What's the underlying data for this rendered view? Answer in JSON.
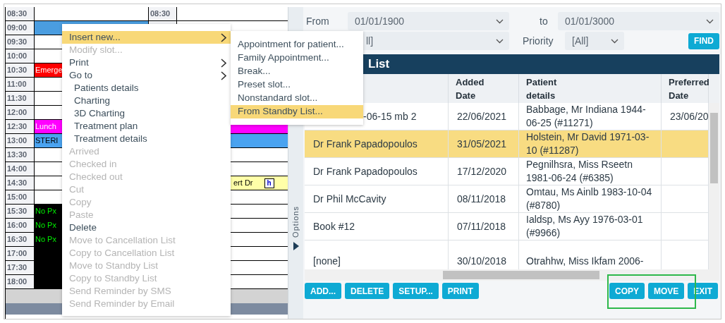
{
  "calendar": {
    "rows": [
      {
        "time": "08:30",
        "time_right": "08:30",
        "left": null,
        "right": null
      },
      {
        "time": "09:00",
        "left": {
          "kind": "appointment",
          "color": "#4a9de0"
        },
        "right": null
      },
      {
        "time": "09:30",
        "left": null,
        "right": null
      },
      {
        "time": "10:00",
        "left": null,
        "right": null
      },
      {
        "time": "10:30",
        "left": {
          "kind": "appointment",
          "color": "#ff0000",
          "text": "Emerge"
        },
        "right": null
      },
      {
        "time": "11:00",
        "left": null,
        "right": null
      },
      {
        "time": "11:30",
        "left": null,
        "right": null
      },
      {
        "time": "12:00",
        "left": null,
        "right": null
      },
      {
        "time": "12:30",
        "left": {
          "kind": "appointment",
          "color": "#ff00ff",
          "text": "Lunch"
        },
        "right": {
          "kind": "appointment",
          "color": "#ff00ff"
        }
      },
      {
        "time": "13:00",
        "left": {
          "kind": "appointment",
          "color": "#4aa3f0",
          "text": "STERI"
        },
        "right": {
          "kind": "appointment",
          "color": "#4aa3f0"
        }
      },
      {
        "time": "13:30",
        "left": null,
        "right": null
      },
      {
        "time": "14:00",
        "left": null,
        "right": null
      },
      {
        "time": "14:30",
        "left": null,
        "right": {
          "kind": "appointment",
          "color": "#ffffa8",
          "text": "ert Dr",
          "badge": "h"
        }
      },
      {
        "time": "15:00",
        "left": null,
        "right": null
      },
      {
        "time": "15:30",
        "left": {
          "kind": "blocked",
          "text": "No Px"
        },
        "right": null
      },
      {
        "time": "16:00",
        "left": {
          "kind": "blocked",
          "text": "No Px"
        },
        "right": null
      },
      {
        "time": "16:30",
        "left": {
          "kind": "blocked",
          "text": "No Px"
        },
        "right": null
      },
      {
        "time": "17:00",
        "left": {
          "kind": "blocked"
        },
        "right": null
      },
      {
        "time": "17:30",
        "left": {
          "kind": "blocked"
        },
        "right": null
      },
      {
        "time": "18:00",
        "left": {
          "kind": "blocked"
        },
        "right": null
      }
    ]
  },
  "context_menu": {
    "items": [
      {
        "label": "Insert new...",
        "disabled": false,
        "selected": true,
        "submenu": true
      },
      {
        "label": "Modify slot...",
        "disabled": true,
        "selected": false,
        "submenu": false
      },
      {
        "label": "Print",
        "disabled": false,
        "selected": false,
        "submenu": true
      },
      {
        "label": "Go to",
        "disabled": false,
        "selected": false,
        "submenu": true,
        "children": [
          {
            "label": "Patients details",
            "disabled": false,
            "selected": false,
            "submenu": false
          },
          {
            "label": "Charting",
            "disabled": false,
            "selected": false,
            "submenu": false
          },
          {
            "label": "3D Charting",
            "disabled": false,
            "selected": false,
            "submenu": false
          },
          {
            "label": "Treatment plan",
            "disabled": false,
            "selected": false,
            "submenu": false
          },
          {
            "label": "Treatment details",
            "disabled": false,
            "selected": false,
            "submenu": false
          }
        ]
      },
      {
        "label": "Arrived",
        "disabled": true,
        "selected": false,
        "submenu": false
      },
      {
        "label": "Checked in",
        "disabled": true,
        "selected": false,
        "submenu": false
      },
      {
        "label": "Checked out",
        "disabled": true,
        "selected": false,
        "submenu": false
      },
      {
        "label": "Cut",
        "disabled": true,
        "selected": false,
        "submenu": false
      },
      {
        "label": "Copy",
        "disabled": true,
        "selected": false,
        "submenu": false
      },
      {
        "label": "Paste",
        "disabled": true,
        "selected": false,
        "submenu": false
      },
      {
        "label": "Delete",
        "disabled": false,
        "selected": false,
        "submenu": false
      },
      {
        "label": "Move to Cancellation List",
        "disabled": true,
        "selected": false,
        "submenu": false
      },
      {
        "label": "Copy to Cancellation List",
        "disabled": true,
        "selected": false,
        "submenu": false
      },
      {
        "label": "Move to Standby List",
        "disabled": true,
        "selected": false,
        "submenu": false
      },
      {
        "label": "Copy to Standby List",
        "disabled": true,
        "selected": false,
        "submenu": false
      },
      {
        "label": "Send Reminder by SMS",
        "disabled": true,
        "selected": false,
        "submenu": false
      },
      {
        "label": "Send Reminder by Email",
        "disabled": true,
        "selected": false,
        "submenu": false
      }
    ]
  },
  "submenu": {
    "items": [
      {
        "label": "Appointment for patient...",
        "selected": false
      },
      {
        "label": "Family Appointment...",
        "selected": false
      },
      {
        "label": "Break...",
        "selected": false
      },
      {
        "label": "Preset slot...",
        "selected": false
      },
      {
        "label": "Nonstandard slot...",
        "selected": false
      },
      {
        "label": "From Standby List...",
        "selected": true
      }
    ]
  },
  "options_tab": {
    "label": "Options"
  },
  "filters": {
    "from": {
      "label": "From",
      "value": "01/01/1900"
    },
    "to": {
      "label": "to",
      "value": "01/01/3000"
    },
    "filter_2": {
      "value": "ll]"
    },
    "priority": {
      "label": "Priority",
      "value": "[All]"
    },
    "find_button": "FIND"
  },
  "list": {
    "title": "List",
    "columns": [
      "",
      "Added Date",
      "Patient details",
      "Preferred Date"
    ],
    "rows": [
      {
        "selected": false,
        "cells": [
          "-06-15 mb 2",
          "22/06/2021",
          "Babbage, Mr Indiana 1944-06-25 (#11271)",
          "23/06/20"
        ]
      },
      {
        "selected": true,
        "cells": [
          "Dr Frank Papadopoulos",
          "31/05/2021",
          "Holstein, Mr David 1971-03-10 (#11287)",
          ""
        ]
      },
      {
        "selected": false,
        "cells": [
          "Dr Frank Papadopoulos",
          "17/12/2020",
          "Pegnilhsra, Miss Rseetn 1981-06-24 (#6385)",
          ""
        ]
      },
      {
        "selected": false,
        "cells": [
          "Dr Phil McCavity",
          "08/11/2018",
          "Omtau, Ms Ainlb 1983-10-04 (#8780)",
          ""
        ]
      },
      {
        "selected": false,
        "cells": [
          "Book #12",
          "07/11/2018",
          "Ialdsp, Ms Ayy 1976-03-01 (#9966)",
          ""
        ]
      },
      {
        "selected": false,
        "cells": [
          "[none]",
          "30/10/2018",
          "Otrahhw, Miss Ikfam 2006-",
          ""
        ]
      }
    ]
  },
  "buttons_left": [
    "ADD...",
    "DELETE",
    "SETUP...",
    "PRINT"
  ],
  "buttons_right": [
    "COPY",
    "MOVE",
    "EXIT"
  ]
}
